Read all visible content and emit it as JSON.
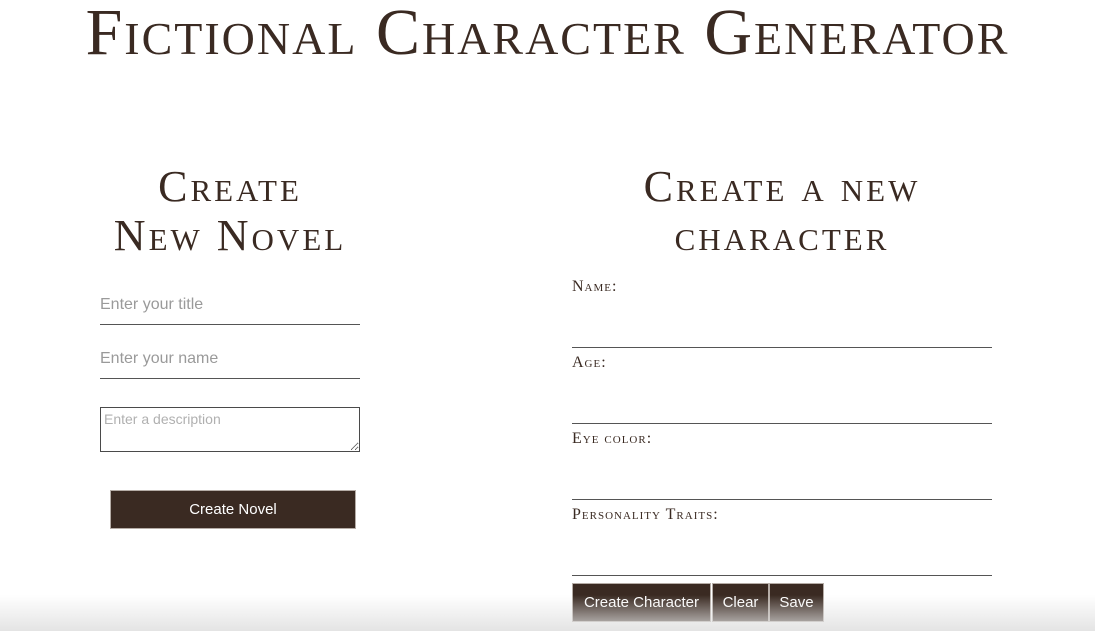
{
  "app": {
    "title": "Fictional Character Generator"
  },
  "novel_form": {
    "heading_line1": "Create",
    "heading_line2": "New Novel",
    "title_placeholder": "Enter your title",
    "title_value": "",
    "name_placeholder": "Enter your name",
    "name_value": "",
    "description_placeholder": "Enter a description",
    "description_value": "",
    "submit_label": "Create Novel"
  },
  "character_form": {
    "heading_line1": "Create a new",
    "heading_line2": "character",
    "fields": [
      {
        "label": "Name:",
        "value": ""
      },
      {
        "label": "Age:",
        "value": ""
      },
      {
        "label": "Eye color:",
        "value": ""
      },
      {
        "label": "Personality Traits:",
        "value": ""
      }
    ],
    "buttons": {
      "create_label": "Create Character",
      "clear_label": "Clear",
      "save_label": "Save"
    }
  },
  "colors": {
    "text": "#3a2a22",
    "button_bg": "#3a2a22",
    "button_text": "#ffffff",
    "background": "#ffffff"
  }
}
